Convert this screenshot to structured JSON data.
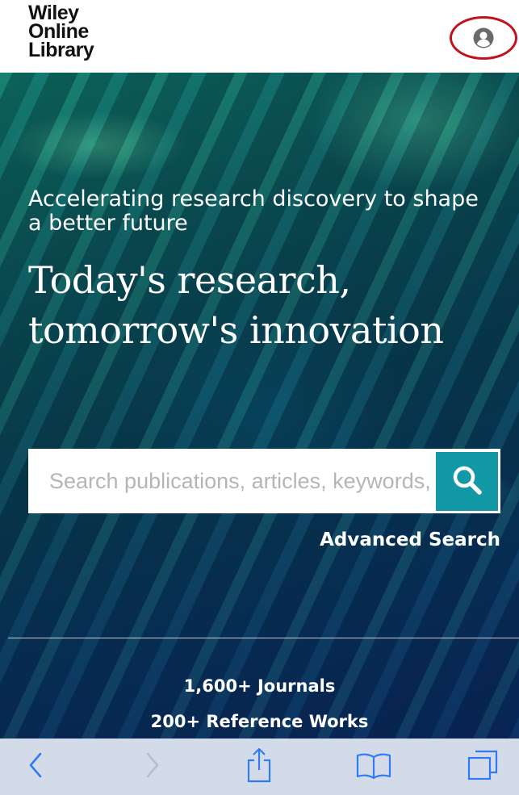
{
  "header": {
    "logo_lines": [
      "Wiley",
      "Online",
      "Library"
    ],
    "account_icon": "user-circle-icon"
  },
  "hero": {
    "tagline": "Accelerating research discovery to shape a better future",
    "headline": "Today's research, tomorrow's innovation",
    "search": {
      "placeholder": "Search publications, articles, keywords, etc.",
      "value": "",
      "button_icon": "search-icon"
    },
    "advanced_search_label": "Advanced Search",
    "stats": [
      "1,600+ Journals",
      "200+ Reference Works"
    ]
  },
  "toolbar": {
    "icons": [
      "chevron-left-icon",
      "chevron-right-icon",
      "share-icon",
      "book-icon",
      "tabs-icon"
    ]
  },
  "colors": {
    "accent": "#1398a5",
    "highlight_ring": "#c1121f",
    "toolbar_bg": "#d4dbe8",
    "toolbar_icon": "#2f7bf6"
  }
}
